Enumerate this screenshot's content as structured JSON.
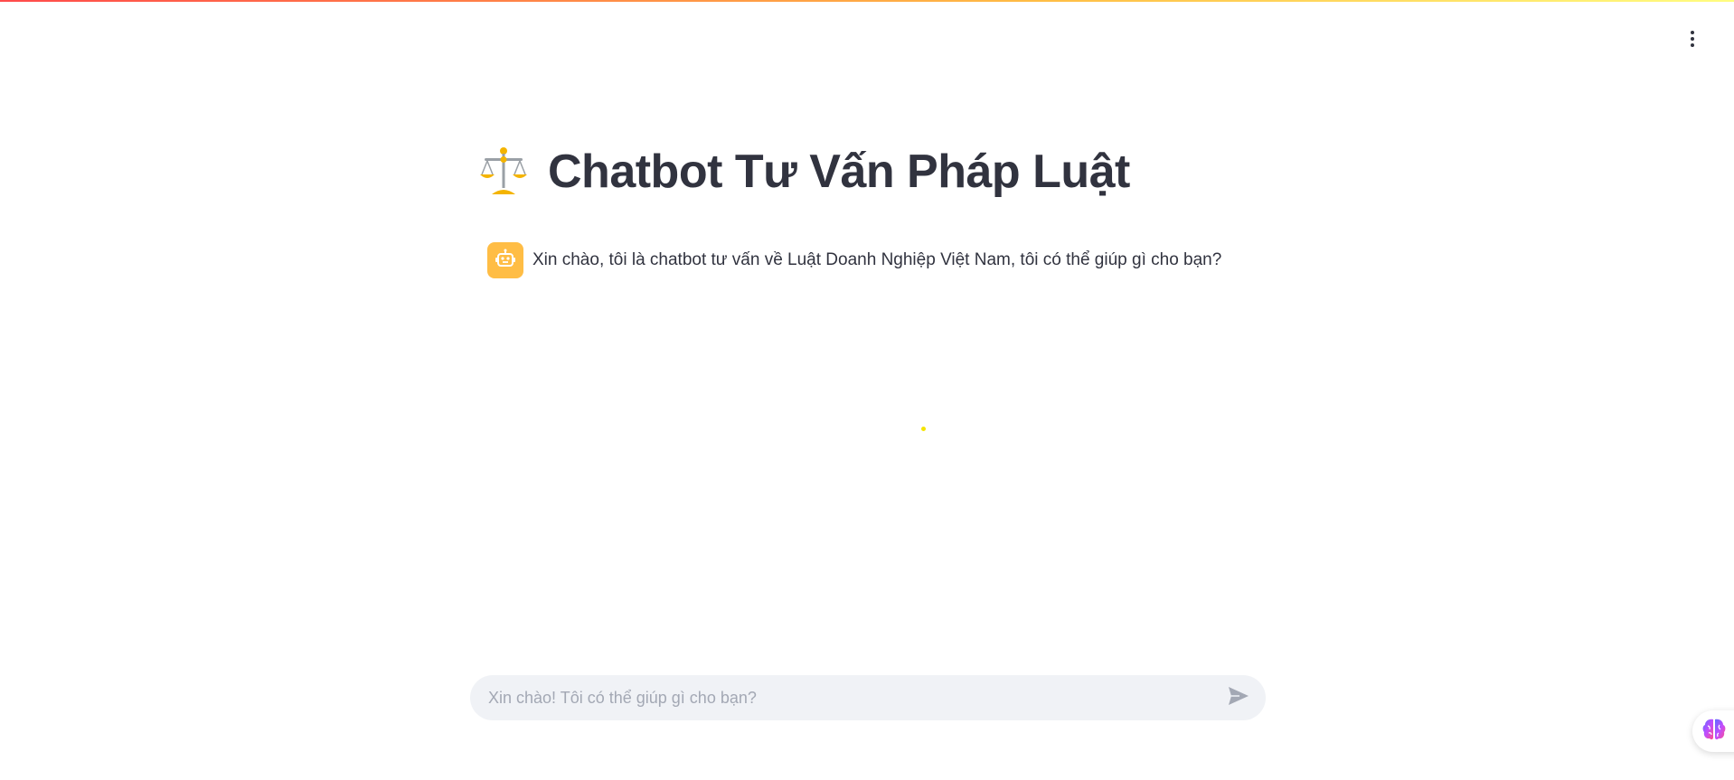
{
  "app": {
    "title": "Chatbot Tư Vấn Pháp Luật",
    "title_icon": "balance-scale-icon"
  },
  "header": {
    "menu_icon": "vertical-dots-menu-icon"
  },
  "messages": [
    {
      "role": "assistant",
      "avatar_icon": "robot-icon",
      "text": "Xin chào, tôi là chatbot tư vấn về Luật Doanh Nghiệp Việt Nam, tôi có thể giúp gì cho bạn?"
    }
  ],
  "chat_input": {
    "value": "",
    "placeholder": "Xin chào! Tôi có thể giúp gì cho bạn?",
    "send_icon": "send-icon"
  },
  "floating_widget": {
    "icon": "brain-icon"
  },
  "colors": {
    "accent": "#ffbd45",
    "text": "#31333f",
    "input_bg": "#f0f2f6"
  }
}
